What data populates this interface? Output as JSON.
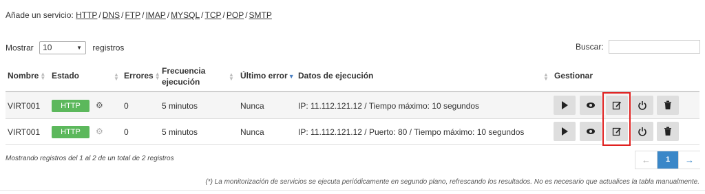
{
  "add_service": {
    "label": "Añade un servicio:",
    "links": [
      "HTTP",
      "DNS",
      "FTP",
      "IMAP",
      "MYSQL",
      "TCP",
      "POP",
      "SMTP"
    ],
    "separator": "/"
  },
  "length": {
    "prefix": "Mostrar",
    "value": "10",
    "suffix": "registros"
  },
  "search": {
    "label": "Buscar:",
    "value": ""
  },
  "table": {
    "headers": {
      "nombre": "Nombre",
      "estado": "Estado",
      "errores": "Errores",
      "frecuencia_1": "Frecuencia",
      "frecuencia_2": "ejecución",
      "ultimo_error": "Último error",
      "datos": "Datos de ejecución",
      "gestionar": "Gestionar"
    },
    "rows": [
      {
        "nombre": "VIRT001",
        "estado": "HTTP",
        "errores": "0",
        "frecuencia": "5 minutos",
        "ultimo_error": "Nunca",
        "datos": "IP: 11.112.121.12 / Tiempo máximo: 10 segundos"
      },
      {
        "nombre": "VIRT001",
        "estado": "HTTP",
        "errores": "0",
        "frecuencia": "5 minutos",
        "ultimo_error": "Nunca",
        "datos": "IP: 11.112.121.12 / Puerto: 80 / Tiempo máximo: 10 segundos"
      }
    ]
  },
  "info": "Mostrando registros del 1 al 2 de un total de 2 registros",
  "pagination": {
    "prev": "←",
    "current": "1",
    "next": "→"
  },
  "note": "(*) La monitorización de servicios se ejecuta periódicamente en segundo plano, refrescando los resultados. No es necesario que actualices la tabla manualmente.",
  "colors": {
    "badge": "#5cb85c",
    "page_active": "#3a87c8",
    "highlight": "#e0201f",
    "button": "#dedede"
  },
  "icons": [
    "play-icon",
    "eye-icon",
    "edit-icon",
    "power-icon",
    "trash-icon",
    "gear-icon"
  ]
}
